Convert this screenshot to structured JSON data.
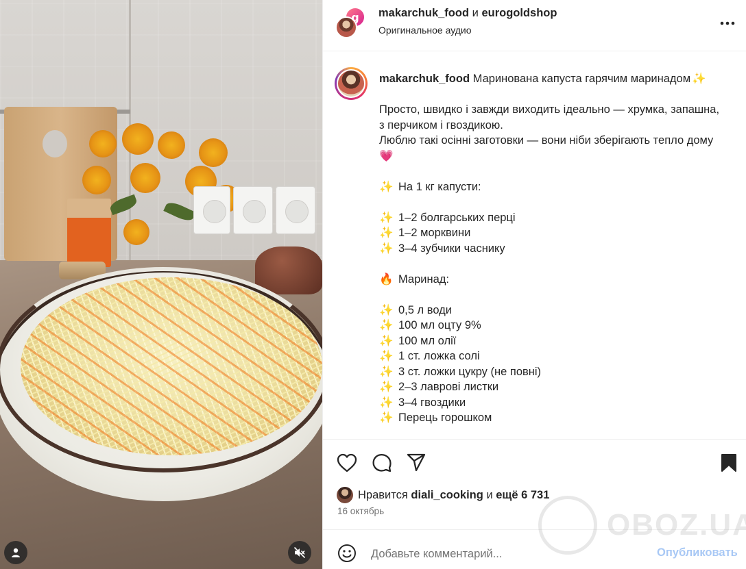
{
  "header": {
    "author": "makarchuk_food",
    "conjunction": "и",
    "coauthor": "eurogoldshop",
    "coauthor_avatar_letter": "g",
    "audio": "Оригинальное аудио"
  },
  "caption": {
    "username": "makarchuk_food",
    "title": "Маринована капуста гарячим маринадом",
    "intro": [
      "Просто, швидко і завжди виходить ідеально — хрумка, запашна,",
      "з перчиком і гвоздикою.",
      "Люблю такі осінні заготовки — вони ніби зберігають тепло дому"
    ],
    "per_kg": "На 1 кг капусти:",
    "ingredients": [
      "1–2 болгарських перці",
      "1–2 морквини",
      "3–4 зубчики часнику"
    ],
    "marinade_label": "Маринад:",
    "marinade": [
      "0,5 л води",
      "100 мл оцту 9%",
      "100 мл олії",
      "1 ст. ложка солі",
      "3 ст. ложки цукру (не повні)",
      "2–3 лаврові листки",
      "3–4 гвоздики",
      "Перець горошком"
    ]
  },
  "icons": {
    "sparkle": "✨",
    "fire": "🔥",
    "heart": "💗"
  },
  "likes": {
    "prefix": "Нравится",
    "user": "diali_cooking",
    "middle": "и",
    "rest": "ещё 6 731"
  },
  "date": "16 октябрь",
  "comment": {
    "placeholder": "Добавьте комментарий...",
    "publish": "Опубликовать"
  },
  "watermark": "OBOZ.UA",
  "colors": {
    "publish": "#a8c8f5",
    "accent_text": "#262626",
    "muted_text": "#737373"
  }
}
